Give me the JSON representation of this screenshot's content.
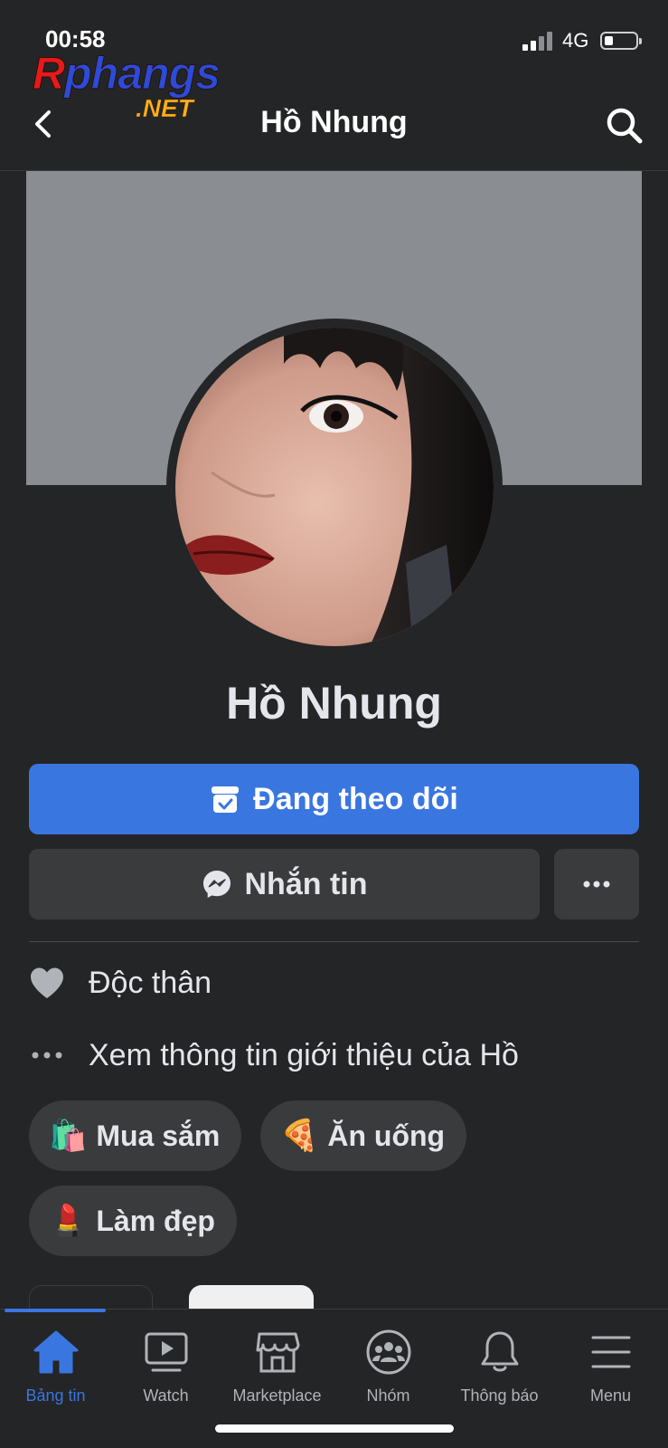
{
  "status_bar": {
    "time": "00:58",
    "network": "4G"
  },
  "watermark": {
    "part1": "R",
    "part2": "phangs",
    "part3": ".NET"
  },
  "header": {
    "title": "Hồ Nhung"
  },
  "profile": {
    "name": "Hồ Nhung"
  },
  "actions": {
    "follow_label": "Đang theo dõi",
    "message_label": "Nhắn tin"
  },
  "info": {
    "relationship": "Độc thân",
    "see_about": "Xem thông tin giới thiệu của Hồ"
  },
  "interests": [
    {
      "emoji": "🛍️",
      "label": "Mua sắm"
    },
    {
      "emoji": "🍕",
      "label": "Ăn uống"
    },
    {
      "emoji": "💄",
      "label": "Làm đẹp"
    }
  ],
  "tabs": [
    {
      "label": "Bảng tin",
      "icon": "home-icon",
      "active": true
    },
    {
      "label": "Watch",
      "icon": "watch-icon"
    },
    {
      "label": "Marketplace",
      "icon": "marketplace-icon"
    },
    {
      "label": "Nhóm",
      "icon": "groups-icon"
    },
    {
      "label": "Thông báo",
      "icon": "bell-icon"
    },
    {
      "label": "Menu",
      "icon": "menu-icon"
    }
  ],
  "colors": {
    "background": "#242526",
    "accent": "#3a76e0",
    "button_secondary": "#3a3b3c",
    "cover": "#8a8d91"
  }
}
